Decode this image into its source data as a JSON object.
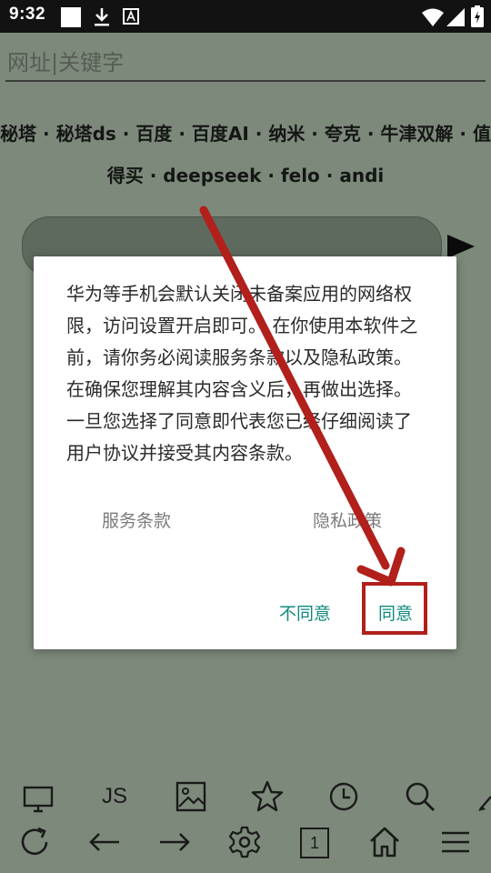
{
  "status_bar": {
    "time": "9:32",
    "icons": [
      "stop-square-icon",
      "download-icon",
      "font-a-icon",
      "wifi-icon",
      "signal-icon",
      "battery-charging-icon"
    ]
  },
  "browser": {
    "url_placeholder": "网址|关键字",
    "quick_links": [
      "秘塔",
      "秘塔ds",
      "百度",
      "百度AI",
      "纳米",
      "夸克",
      "牛津双解",
      "值得买",
      "deepseek",
      "felo",
      "andi"
    ],
    "link_separator": " · "
  },
  "dialog": {
    "message": "华为等手机会默认关闭未备案应用的网络权限，访问设置开启即可。 在你使用本软件之前，请你务必阅读服务条款以及隐私政策。在确保您理解其内容含义后，再做出选择。一旦您选择了同意即代表您已经仔细阅读了用户协议并接受其内容条款。",
    "terms_link": "服务条款",
    "privacy_link": "隐私政策",
    "disagree_button": "不同意",
    "agree_button": "同意"
  },
  "toolbar": {
    "row1": [
      "desktop-icon",
      "js-icon",
      "image-icon",
      "star-icon",
      "history-icon",
      "search-icon",
      "more-icon"
    ],
    "js_label": "JS",
    "row2": [
      "refresh-icon",
      "back-arrow-icon",
      "forward-arrow-icon",
      "settings-icon",
      "tab-count-icon",
      "home-icon",
      "menu-icon"
    ],
    "tab_count": "1"
  },
  "colors": {
    "background": "#7d8a7b",
    "dialog_button": "#11897c",
    "annotation": "#b1201b"
  }
}
